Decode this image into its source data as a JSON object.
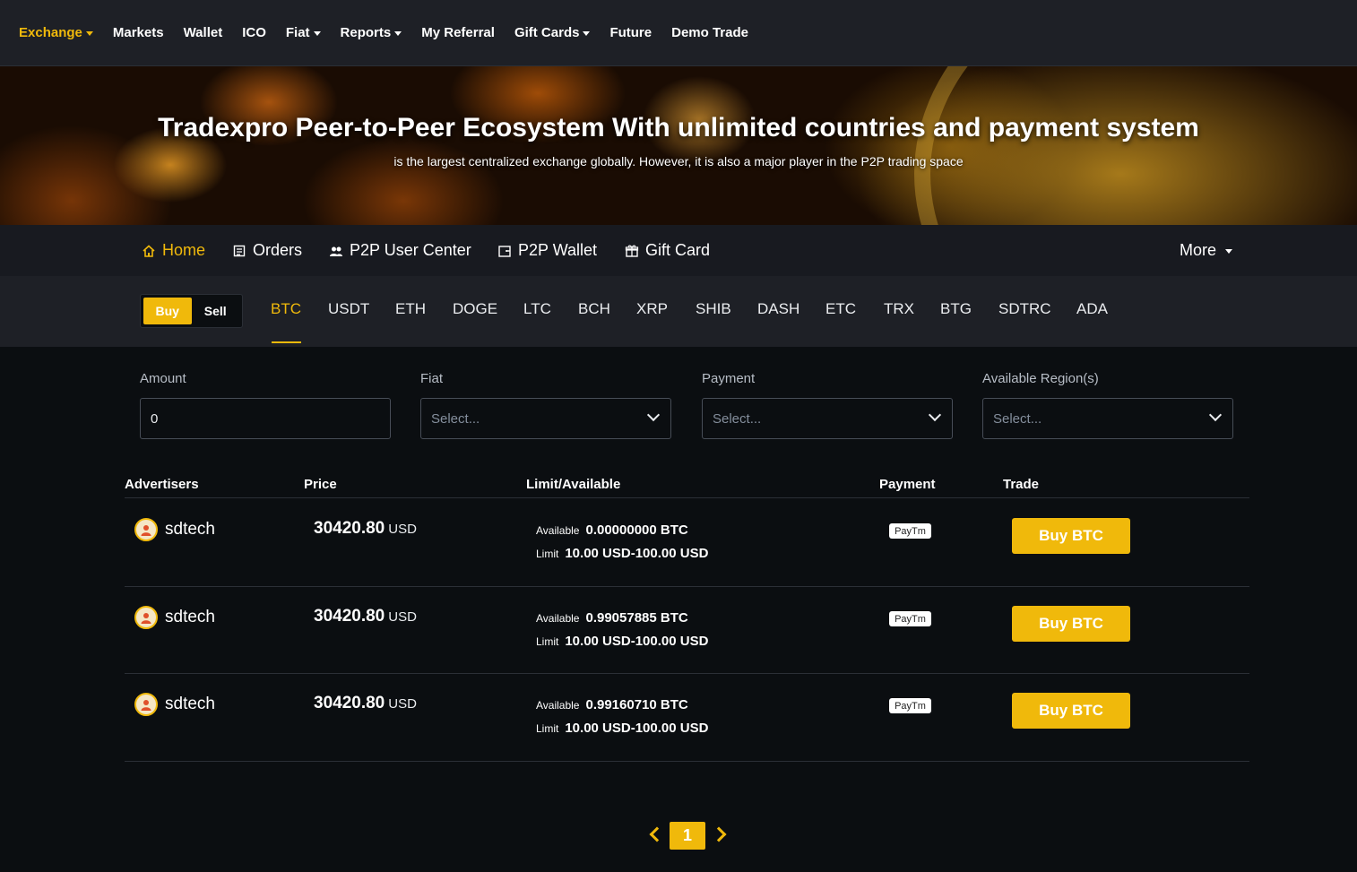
{
  "topnav": {
    "items": [
      {
        "label": "Exchange",
        "dropdown": true,
        "active": true
      },
      {
        "label": "Markets"
      },
      {
        "label": "Wallet"
      },
      {
        "label": "ICO"
      },
      {
        "label": "Fiat",
        "dropdown": true
      },
      {
        "label": "Reports",
        "dropdown": true
      },
      {
        "label": "My Referral"
      },
      {
        "label": "Gift Cards",
        "dropdown": true
      },
      {
        "label": "Future"
      },
      {
        "label": "Demo Trade"
      }
    ]
  },
  "hero": {
    "title": "Tradexpro Peer-to-Peer Ecosystem With unlimited countries and payment system",
    "subtitle": "is the largest centralized exchange globally. However, it is also a major player in the P2P trading space"
  },
  "subnav": {
    "home": "Home",
    "orders": "Orders",
    "user_center": "P2P User Center",
    "wallet": "P2P Wallet",
    "gift_card": "Gift Card",
    "more": "More"
  },
  "trade_toggle": {
    "buy": "Buy",
    "sell": "Sell"
  },
  "coins": [
    "BTC",
    "USDT",
    "ETH",
    "DOGE",
    "LTC",
    "BCH",
    "XRP",
    "SHIB",
    "DASH",
    "ETC",
    "TRX",
    "BTG",
    "SDTRC",
    "ADA"
  ],
  "filters": {
    "amount_label": "Amount",
    "amount_value": "0",
    "fiat_label": "Fiat",
    "fiat_placeholder": "Select...",
    "payment_label": "Payment",
    "payment_placeholder": "Select...",
    "region_label": "Available Region(s)",
    "region_placeholder": "Select..."
  },
  "table": {
    "headers": {
      "advertisers": "Advertisers",
      "price": "Price",
      "limit": "Limit/Available",
      "payment": "Payment",
      "trade": "Trade"
    },
    "available_label": "Available",
    "limit_label": "Limit",
    "rows": [
      {
        "advertiser": "sdtech",
        "price": "30420.80",
        "currency": "USD",
        "available": "0.00000000 BTC",
        "limit": "10.00 USD-100.00 USD",
        "payment": "PayTm",
        "action": "Buy BTC"
      },
      {
        "advertiser": "sdtech",
        "price": "30420.80",
        "currency": "USD",
        "available": "0.99057885 BTC",
        "limit": "10.00 USD-100.00 USD",
        "payment": "PayTm",
        "action": "Buy BTC"
      },
      {
        "advertiser": "sdtech",
        "price": "30420.80",
        "currency": "USD",
        "available": "0.99160710 BTC",
        "limit": "10.00 USD-100.00 USD",
        "payment": "PayTm",
        "action": "Buy BTC"
      }
    ]
  },
  "pagination": {
    "current": "1"
  },
  "colors": {
    "accent": "#f0b90b",
    "background": "#0b0e11",
    "panel": "#1e2026"
  }
}
